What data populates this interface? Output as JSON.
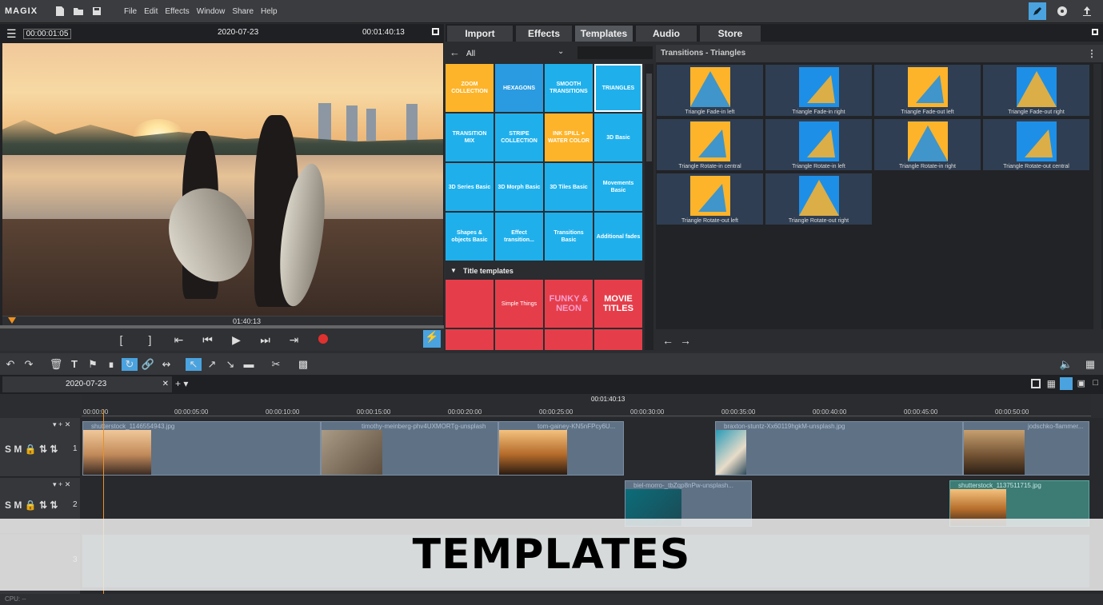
{
  "app": {
    "logo": "MAGIX"
  },
  "menu": [
    "File",
    "Edit",
    "Effects",
    "Window",
    "Share",
    "Help"
  ],
  "preview": {
    "timecode": "00:00:01:05",
    "date": "2020-07-23",
    "end_time": "00:01:40:13",
    "position": "01:40:13"
  },
  "pool": {
    "tabs": [
      "Import",
      "Effects",
      "Templates",
      "Audio",
      "Store"
    ],
    "active_tab": "Templates",
    "filter": "All",
    "section_title": "Title templates",
    "tiles": [
      "ZOOM COLLECTION",
      "HEXAGONS",
      "SMOOTH TRANSITIONS",
      "TRIANGLES",
      "TRANSITION MIX",
      "STRIPE COLLECTION",
      "INK SPILL + WATER COLOR",
      "3D Basic",
      "3D Series Basic",
      "3D Morph Basic",
      "3D Tiles Basic",
      "Movements Basic",
      "Shapes & objects Basic",
      "Effect transition...",
      "Transitions Basic",
      "Additional fades"
    ],
    "title_tiles": [
      "",
      "Simple Things",
      "FUNKY & NEON",
      "MOVIE TITLES"
    ],
    "panel_title": "Transitions - Triangles",
    "thumbs": [
      "Triangle Fade-in left",
      "Triangle Fade-in right",
      "Triangle Fade-out left",
      "Triangle Fade-out right",
      "Triangle Rotate-in central",
      "Triangle Rotate-in left",
      "Triangle Rotate-in right",
      "Triangle Rotate-out central",
      "Triangle Rotate-out left",
      "Triangle Rotate-out right"
    ]
  },
  "timeline": {
    "arrangement": "2020-07-23",
    "cursor_time": "00:01:40:13",
    "ruler": [
      "00:00:00",
      "00:00:05:00",
      "00:00:10:00",
      "00:00:15:00",
      "00:00:20:00",
      "00:00:25:00",
      "00:00:30:00",
      "00:00:35:00",
      "00:00:40:00",
      "00:00:45:00",
      "00:00:50:00"
    ],
    "track_labels": {
      "solo": "S",
      "mute": "M"
    },
    "track_numbers": [
      "1",
      "2",
      "3"
    ],
    "clips_t1": [
      "shutterstock_1146554943.jpg",
      "timothy-meinberg-phv4UXMORTg-unsplash",
      "tom-gainey-KN5nFPcy6U...",
      "braxton-stuntz-Xx60119hgkM-unsplash.jpg",
      "jodschko-flammer..."
    ],
    "clips_t2": [
      "biel-morro-_tbZqp8nPw-unsplash...",
      "shutterstock_1137511715.jpg"
    ]
  },
  "overlay_title": "TEMPLATES",
  "status": "CPU: --",
  "colors": {
    "accent": "#4aa3df",
    "tile_blue": "#1fb0ec",
    "tile_yellow": "#fdb42a",
    "tile_red": "#e53e4a"
  }
}
